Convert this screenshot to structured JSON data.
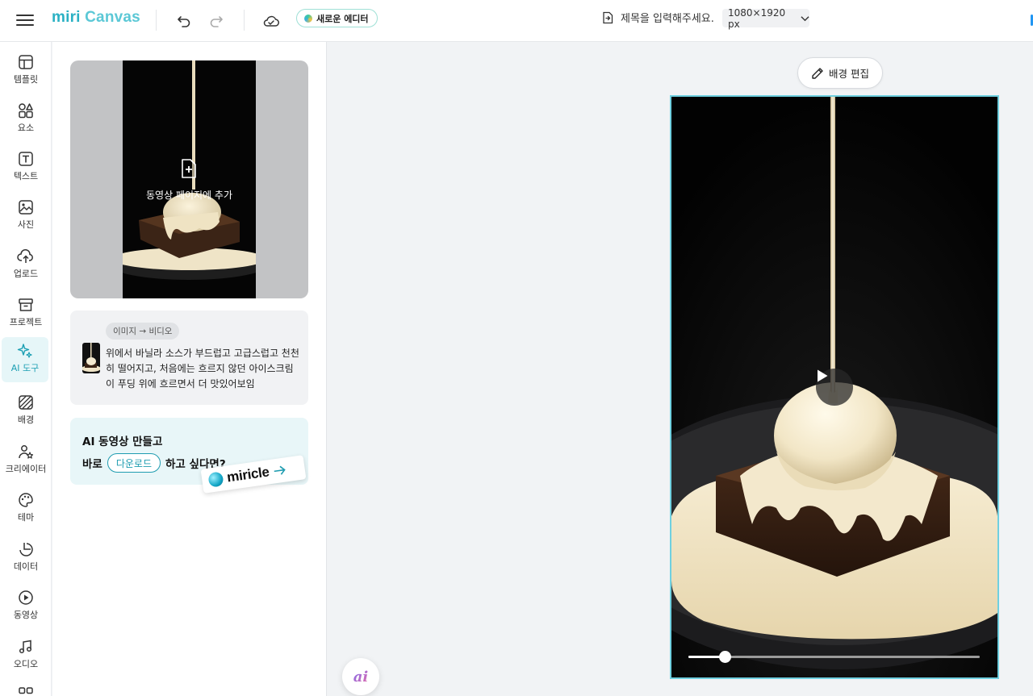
{
  "header": {
    "logo_a": "miri",
    "logo_b": "Canvas",
    "new_editor_label": "새로운 에디터",
    "title_placeholder": "제목을 입력해주세요.",
    "canvas_size": "1080×1920 px"
  },
  "rail": {
    "items": [
      {
        "label": "템플릿",
        "icon": "template-icon"
      },
      {
        "label": "요소",
        "icon": "elements-icon"
      },
      {
        "label": "텍스트",
        "icon": "text-icon"
      },
      {
        "label": "사진",
        "icon": "photo-icon"
      },
      {
        "label": "업로드",
        "icon": "upload-icon"
      },
      {
        "label": "프로젝트",
        "icon": "project-icon"
      },
      {
        "label": "AI 도구",
        "icon": "sparkle-icon",
        "active": true
      },
      {
        "label": "배경",
        "icon": "background-icon"
      },
      {
        "label": "크리에이터",
        "icon": "creator-icon"
      },
      {
        "label": "테마",
        "icon": "palette-icon"
      },
      {
        "label": "데이터",
        "icon": "chart-icon"
      },
      {
        "label": "동영상",
        "icon": "video-icon"
      },
      {
        "label": "오디오",
        "icon": "music-icon"
      }
    ]
  },
  "panel": {
    "add_to_page_label": "동영상 페이지에 추가",
    "prompt_tag": "이미지 → 비디오",
    "prompt_text": "위에서 바닐라 소스가 부드럽고 고급스럽고 천천히 떨어지고, 처음에는 흐르지 않던 아이스크림이 푸딩 위에 흐르면서 더 맛있어보임",
    "promo_line1": "AI 동영상 만들고",
    "promo_line2_before": "바로",
    "promo_download": "다운로드",
    "promo_line2_after": "하고 싶다면?",
    "promo_brand": "miricle"
  },
  "canvas": {
    "bg_edit_label": "배경 편집",
    "playback_progress": 0.125
  },
  "colors": {
    "accent": "#1c9fb3",
    "artboard_border": "#6fd0e0"
  }
}
